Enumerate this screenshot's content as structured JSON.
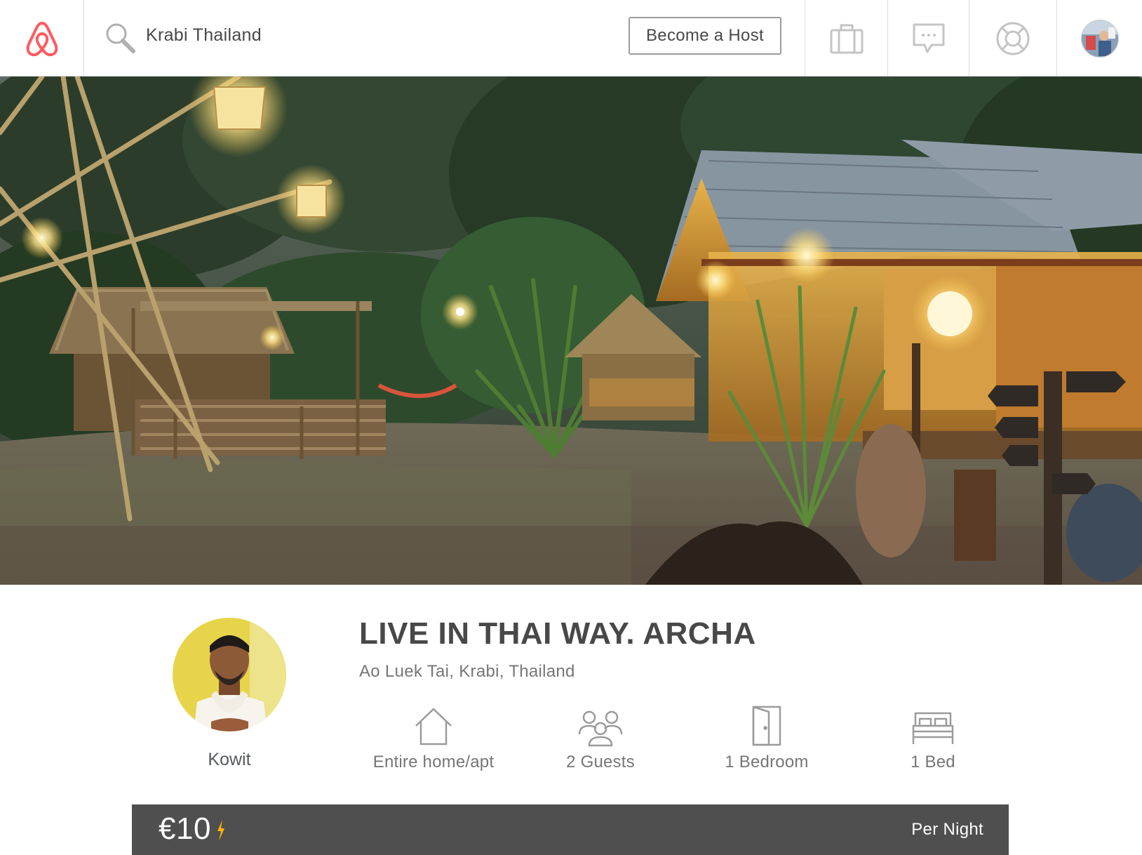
{
  "header": {
    "logo_icon": "airbnb-logo-icon",
    "search": {
      "value": "Krabi Thailand",
      "icon": "search-icon"
    },
    "become_host_label": "Become a Host",
    "trips_icon": "suitcase-icon",
    "messages_icon": "chat-bubble-icon",
    "help_icon": "lifebuoy-icon",
    "avatar_icon": "user-avatar"
  },
  "listing": {
    "title": "LIVE IN THAI WAY. ARCHA",
    "location": "Ao Luek Tai, Krabi, Thailand",
    "host": {
      "name": "Kowit"
    },
    "amenities": [
      {
        "icon": "house-icon",
        "label": "Entire home/apt"
      },
      {
        "icon": "guests-icon",
        "label": "2 Guests"
      },
      {
        "icon": "door-icon",
        "label": "1 Bedroom"
      },
      {
        "icon": "bed-icon",
        "label": "1 Bed"
      }
    ]
  },
  "price": {
    "value": "€10",
    "instant_book_icon": "lightning-bolt-icon",
    "period": "Per Night"
  },
  "colors": {
    "brand": "#FF5A5F",
    "text": "#484848",
    "muted": "#767676",
    "price_bar": "#4F4F4F",
    "bolt": "#FFB400"
  }
}
